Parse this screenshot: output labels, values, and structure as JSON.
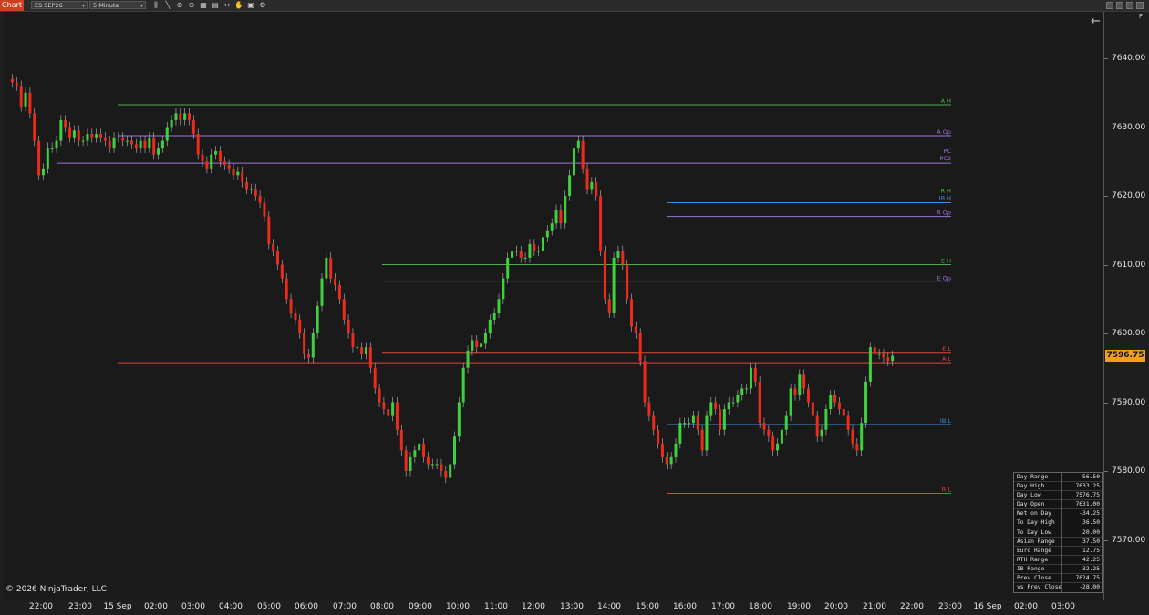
{
  "toolbar": {
    "chart_tab": "Chart",
    "instrument": "ES SEP26",
    "interval": "5 Minute",
    "tools": [
      "bars-icon",
      "draw-icon",
      "zoom-in-icon",
      "zoom-out-icon",
      "properties-icon",
      "templates-icon",
      "scroll-icon",
      "hand-icon",
      "data-box-icon",
      "strategy-icon"
    ]
  },
  "current_price": "7596.75",
  "copyright": "© 2026 NinjaTrader, LLC",
  "f_label": "F",
  "price_axis": {
    "min": 7565,
    "max": 7646,
    "labels": [
      "7640.00",
      "7630.00",
      "7620.00",
      "7610.00",
      "7600.00",
      "7590.00",
      "7580.00",
      "7570.00"
    ]
  },
  "time_axis": {
    "labels": [
      "22:00",
      "23:00",
      "15 Sep",
      "02:00",
      "03:00",
      "04:00",
      "05:00",
      "06:00",
      "07:00",
      "08:00",
      "09:00",
      "10:00",
      "11:00",
      "12:00",
      "13:00",
      "14:00",
      "15:00",
      "16:00",
      "17:00",
      "18:00",
      "19:00",
      "20:00",
      "21:00",
      "22:00",
      "23:00",
      "16 Sep",
      "02:00",
      "03:00"
    ]
  },
  "levels": [
    {
      "label": "A H",
      "price": 7633.25,
      "color": "#4fae4f"
    },
    {
      "label": "A Op",
      "price": 7628.75,
      "color": "#a070e0"
    },
    {
      "label": "PC",
      "price": 7624.75,
      "color": "#a070e0"
    },
    {
      "label": "PC2",
      "price": 7624.75,
      "color": "#a070e0"
    },
    {
      "label": "R H",
      "price": 7619.0,
      "color": "#4fae4f"
    },
    {
      "label": "IB H",
      "price": 7619.0,
      "color": "#3e8ee0"
    },
    {
      "label": "R Op",
      "price": 7617.0,
      "color": "#a070e0"
    },
    {
      "label": "E H",
      "price": 7610.0,
      "color": "#4fae4f"
    },
    {
      "label": "E Op",
      "price": 7607.5,
      "color": "#a070e0"
    },
    {
      "label": "E L",
      "price": 7597.25,
      "color": "#e0443a"
    },
    {
      "label": "A L",
      "price": 7595.75,
      "color": "#e0443a"
    },
    {
      "label": "IB L",
      "price": 7586.75,
      "color": "#3e8ee0"
    },
    {
      "label": "R L",
      "price": 7576.75,
      "color": "#e0443a"
    }
  ],
  "stats": [
    {
      "k": "Day Range",
      "v": "56.50"
    },
    {
      "k": "Day High",
      "v": "7633.25"
    },
    {
      "k": "Day Low",
      "v": "7576.75"
    },
    {
      "k": "Day Open",
      "v": "7631.00"
    },
    {
      "k": "Net on Day",
      "v": "-34.25"
    },
    {
      "k": "To Day High",
      "v": "36.50"
    },
    {
      "k": "To Day Low",
      "v": "20.00"
    },
    {
      "k": "Asian Range",
      "v": "37.50"
    },
    {
      "k": "Euro Range",
      "v": "12.75"
    },
    {
      "k": "RTH Range",
      "v": "42.25"
    },
    {
      "k": "IB Range",
      "v": "32.25"
    },
    {
      "k": "Prev Close",
      "v": "7624.75"
    },
    {
      "k": "vs Prev Close",
      "v": "-28.00"
    }
  ],
  "chart_data": {
    "type": "candlestick",
    "instrument": "ES SEP26",
    "interval": "5 Minute",
    "closes": [
      7636.5,
      7636,
      7633,
      7635,
      7632,
      7628,
      7623,
      7624,
      7627,
      7627,
      7628,
      7631,
      7630,
      7628.5,
      7629.5,
      7628,
      7628,
      7629,
      7628.5,
      7629,
      7628.5,
      7628,
      7627,
      7628.5,
      7628.5,
      7628,
      7628,
      7627.5,
      7627,
      7628,
      7627,
      7628.5,
      7626,
      7627,
      7628,
      7630,
      7631,
      7632,
      7631,
      7632,
      7631,
      7629,
      7626,
      7625,
      7624,
      7626,
      7626.5,
      7625,
      7624.5,
      7624,
      7623,
      7623.5,
      7622,
      7621,
      7621,
      7620,
      7619,
      7617,
      7613,
      7612,
      7610,
      7608,
      7605,
      7603,
      7602,
      7600,
      7597,
      7596.5,
      7600,
      7604,
      7608,
      7611,
      7608,
      7607,
      7605,
      7602,
      7600,
      7598,
      7598,
      7597,
      7598,
      7595,
      7592,
      7590,
      7589,
      7588,
      7590,
      7586,
      7583,
      7580,
      7582,
      7583,
      7584,
      7582,
      7581,
      7581,
      7581,
      7580,
      7579,
      7581,
      7585,
      7590,
      7595,
      7597.5,
      7599,
      7598,
      7598.5,
      7600,
      7602,
      7603,
      7605,
      7608,
      7611,
      7612,
      7612,
      7611,
      7611,
      7613,
      7612,
      7612,
      7614,
      7615,
      7616,
      7618,
      7616,
      7620,
      7623,
      7627,
      7628,
      7624,
      7621,
      7622,
      7620,
      7612,
      7605,
      7603,
      7611,
      7612,
      7610,
      7605,
      7601,
      7600,
      7596,
      7590,
      7588,
      7586,
      7584,
      7582,
      7581,
      7582,
      7584,
      7587,
      7587,
      7587,
      7588,
      7586,
      7583,
      7588,
      7590,
      7589,
      7586,
      7589,
      7590,
      7590,
      7591,
      7592,
      7592,
      7595,
      7593,
      7587,
      7586,
      7585,
      7583,
      7584,
      7586,
      7588,
      7592,
      7591,
      7594,
      7592,
      7590,
      7588,
      7585,
      7586,
      7589,
      7591,
      7590,
      7589,
      7588,
      7586,
      7584,
      7583,
      7587,
      7593,
      7598,
      7597,
      7597,
      7596.5,
      7596,
      7596.75
    ]
  }
}
